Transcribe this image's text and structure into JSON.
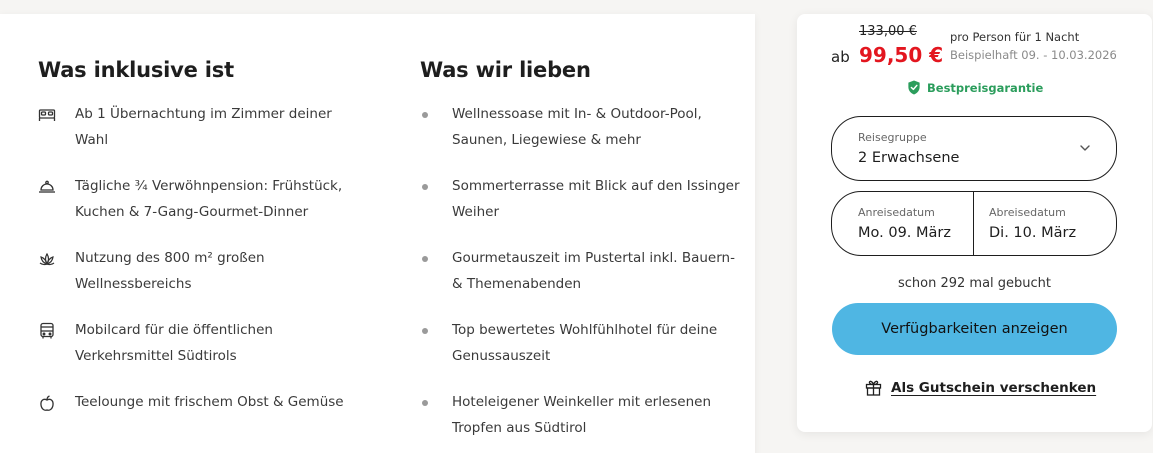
{
  "included": {
    "title": "Was inklusive ist",
    "items": [
      {
        "icon": "bed-icon",
        "text": "Ab 1 Übernachtung im Zimmer deiner Wahl"
      },
      {
        "icon": "cloche-icon",
        "text": "Tägliche ¾ Verwöhnpension: Frühstück, Kuchen & 7-Gang-Gourmet-Dinner"
      },
      {
        "icon": "lotus-icon",
        "text": "Nutzung des 800 m² großen Wellnessbereichs"
      },
      {
        "icon": "bus-icon",
        "text": "Mobilcard für die öffentlichen Verkehrsmittel Südtirols"
      },
      {
        "icon": "apple-icon",
        "text": "Teelounge mit frischem Obst & Gemüse"
      }
    ]
  },
  "loved": {
    "title": "Was wir lieben",
    "items": [
      {
        "text": "Wellnessoase mit In- & Outdoor-Pool, Saunen, Liegewiese & mehr"
      },
      {
        "text": "Sommerterrasse mit Blick auf den Issinger Weiher"
      },
      {
        "text": "Gourmetauszeit im Pustertal inkl. Bauern- & Themenabenden"
      },
      {
        "text": "Top bewertetes Wohlfühlhotel für deine Genussauszeit"
      },
      {
        "text": "Hoteleigener Weinkeller mit erlesenen Tropfen aus Südtirol"
      }
    ]
  },
  "booking": {
    "old_price": "133,00 €",
    "prefix": "ab",
    "price": "99,50 €",
    "per_person": "pro Person für 1 Nacht",
    "example": "Beispielhaft 09. - 10.03.2026",
    "best_price": "Bestpreisgarantie",
    "travel_group_label": "Reisegruppe",
    "travel_group_value": "2 Erwachsene",
    "arrival_label": "Anreisedatum",
    "arrival_value": "Mo. 09. März",
    "departure_label": "Abreisedatum",
    "departure_value": "Di. 10. März",
    "booked_count": "schon 292 mal gebucht",
    "cta": "Verfügbarkeiten anzeigen",
    "gift": "Als Gutschein verschenken"
  },
  "colors": {
    "price_red": "#e3161f",
    "guarantee_green": "#2b9d5c",
    "cta_blue": "#4fb6e3"
  }
}
